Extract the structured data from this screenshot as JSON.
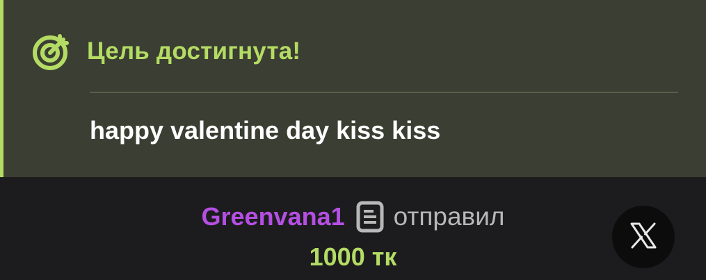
{
  "goal": {
    "icon": "target-arrow-icon",
    "title": "Цель достигнута!",
    "message": "happy valentine day kiss kiss"
  },
  "tip": {
    "sender": "Greenvana1",
    "sender_icon": "document-icon",
    "action": "отправил",
    "amount": "1000 тк"
  },
  "close": {
    "icon": "x-logo-icon"
  },
  "colors": {
    "accent": "#b4dc64",
    "sender": "#b54fe3",
    "card_bg": "#3b3e32",
    "bar_bg": "#1c1c1e"
  }
}
